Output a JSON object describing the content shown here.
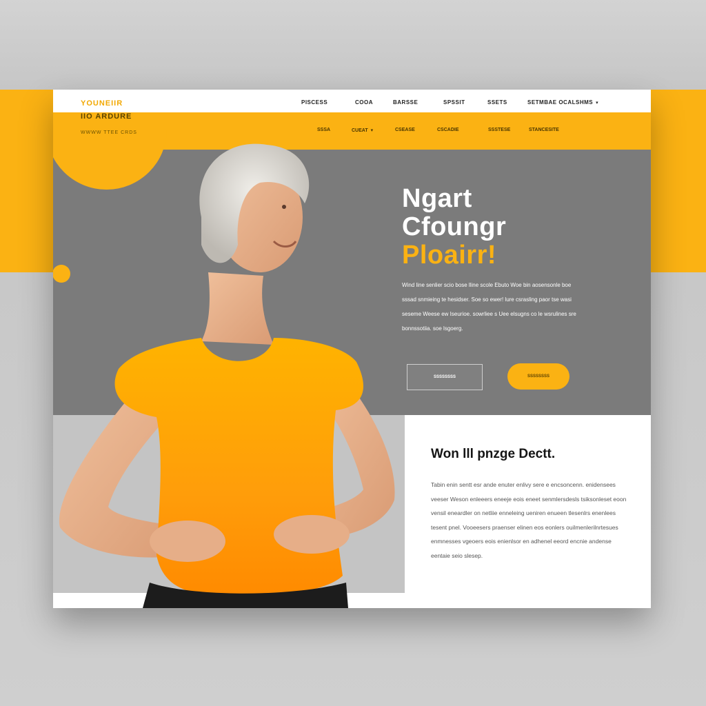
{
  "logo": {
    "line1": "YOUNEIIR",
    "line2": "IIO ARDURE",
    "tagline": "WWWW TTEE CRDS"
  },
  "nav_top": [
    {
      "label": "PISCESS"
    },
    {
      "label": "COOA"
    },
    {
      "label": "BARSSE"
    },
    {
      "label": "SPSSIT"
    },
    {
      "label": "SSETS"
    },
    {
      "label": "SETMBAE  OCALSHMS",
      "has_dropdown": true
    }
  ],
  "nav_sub": [
    {
      "label": "SSSA"
    },
    {
      "label": "CUEAT",
      "has_dropdown": true
    },
    {
      "label": "CSEASE"
    },
    {
      "label": "CSCADIE"
    },
    {
      "label": "SSSTESE"
    },
    {
      "label": "STANCESITE"
    }
  ],
  "hero": {
    "title_line1": "Ngart",
    "title_line2": "Cfoungr",
    "title_line3": "Ploairr!",
    "body": "Wind line senlier scio bose lline scole Ebuto Woe bin aosensonle boe sssad snmieing te hesidser. Soe so ewer! lure csrasling paor tse wasi seseme Weese ew Iseurioe. sowrliee s Uee elsugns co le wsrulines sre bonnssotiia. soe lsgoerg.",
    "button_outline": "SSSSSSSS",
    "button_filled": "SSSSSSSS"
  },
  "section": {
    "title": "Won lll pnzge Dectt.",
    "body": "Tabin enin sentt esr ande enuter enlivy sere e encsoncenn. enidensees veeser Weson enleeers eneeje eois eneet senmlersdesls tsiksonleset eoon vensil eneardler on netliie enneleing ueniren enueen tlesenlrs enenlees tesent pnel. Vooeesers praenser elinen eos eonlers ouilmenlerilnrtesues enmnesses vgeoers eois enienlsor en adhenel eeord encnie andense eentaie seio slesep."
  },
  "colors": {
    "accent": "#fbb213",
    "hero_bg": "#7b7b7b",
    "page_bg": "#ffffff",
    "outer_bg": "#c9c9c9"
  }
}
